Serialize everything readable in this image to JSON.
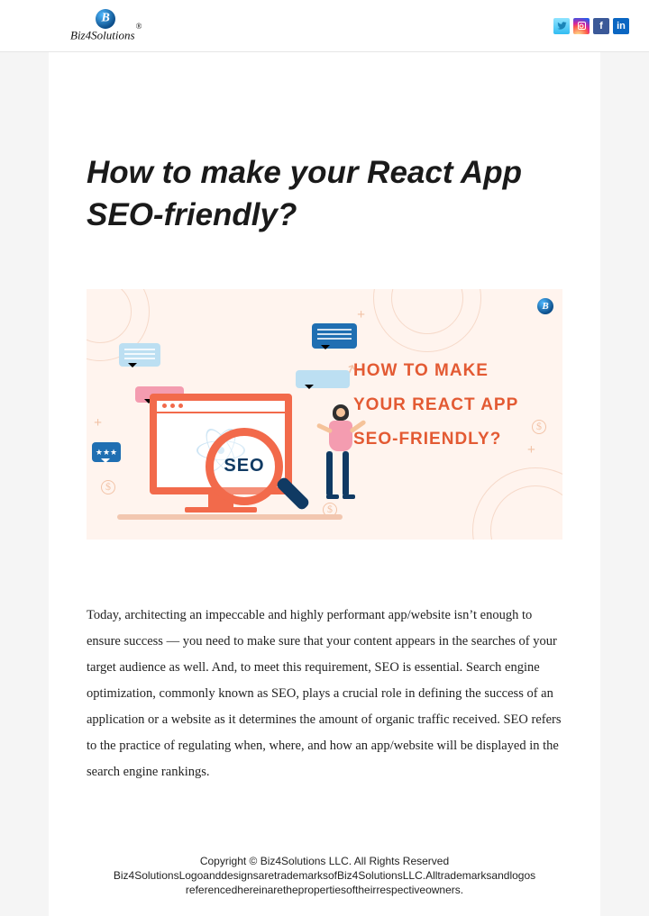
{
  "header": {
    "brand": "Biz4Solutions",
    "brand_badge": "®",
    "brand_letter": "B",
    "social": {
      "twitter": "twitter-icon",
      "instagram": "instagram-icon",
      "facebook": "facebook-icon",
      "linkedin": "linkedin-icon"
    }
  },
  "article": {
    "title": "How to make your React App SEO-friendly?",
    "hero": {
      "seo_badge": "SEO",
      "headline_line1": "HOW TO MAKE",
      "headline_line2": "YOUR REACT APP",
      "headline_line3": "SEO-FRIENDLY?",
      "corner_badge": "B"
    },
    "body": "Today, architecting an impeccable and highly performant app/website isn’t enough to ensure success — you need to make sure that your content appears in the searches of your target audience as well. And, to meet this requirement, SEO is essential. Search engine optimization, commonly known as SEO, plays a crucial role in defining the success of an application or a website as it determines the amount of organic traffic received. SEO refers to the practice of regulating when, where, and how an app/website will be displayed in the search engine rankings."
  },
  "footer": {
    "line1": "Copyright © Biz4Solutions LLC. All Rights Reserved",
    "line2": "Biz4SolutionsLogoanddesignsaretrademarksofBiz4SolutionsLLC.Alltrademarksandlogos",
    "line3": "referencedhereinarethepropertiesoftheirrespectiveowners."
  }
}
